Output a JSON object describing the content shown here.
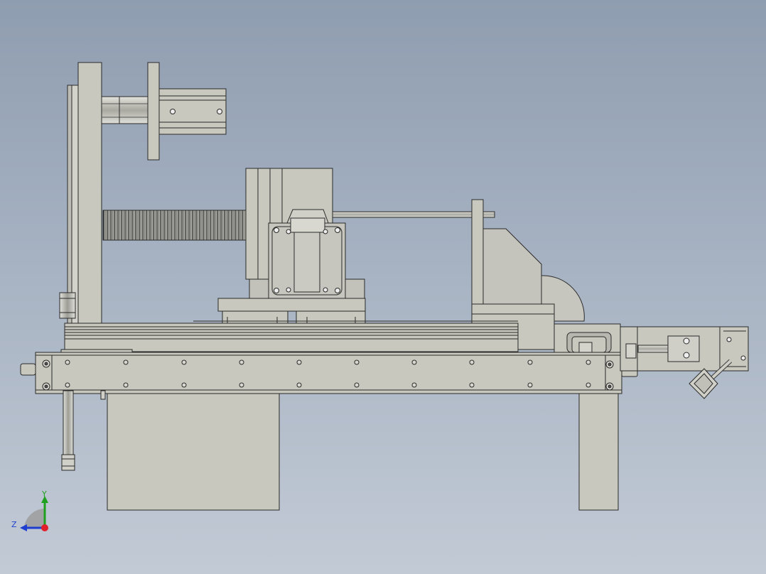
{
  "triad": {
    "y_label": "Y",
    "z_label": "Z",
    "colors": {
      "y_axis": "#1fa01f",
      "z_axis": "#1f3fd0",
      "x_axis": "#e0202a"
    }
  },
  "model_colors": {
    "part_fill": "#c8c8bf",
    "part_fill_dark": "#b9b9b0",
    "edge": "#2a2a2a",
    "background_top": "#8f9db0",
    "background_bottom": "#c2cad5"
  }
}
